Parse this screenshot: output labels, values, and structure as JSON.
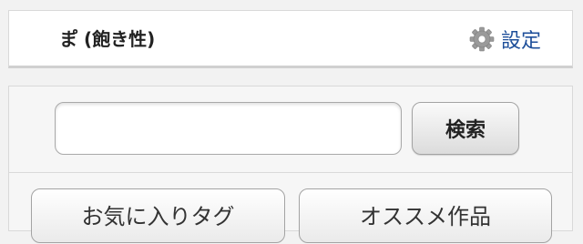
{
  "header": {
    "title": "ま゚ (飽き性)",
    "settings_label": "設定",
    "settings_icon": "gear-icon"
  },
  "search": {
    "input_value": "",
    "placeholder": "",
    "button_label": "検索"
  },
  "tabs": [
    {
      "label": "お気に入りタグ"
    },
    {
      "label": "オススメ作品"
    }
  ],
  "colors": {
    "background": "#f2f2f2",
    "link": "#1e4f9a"
  }
}
